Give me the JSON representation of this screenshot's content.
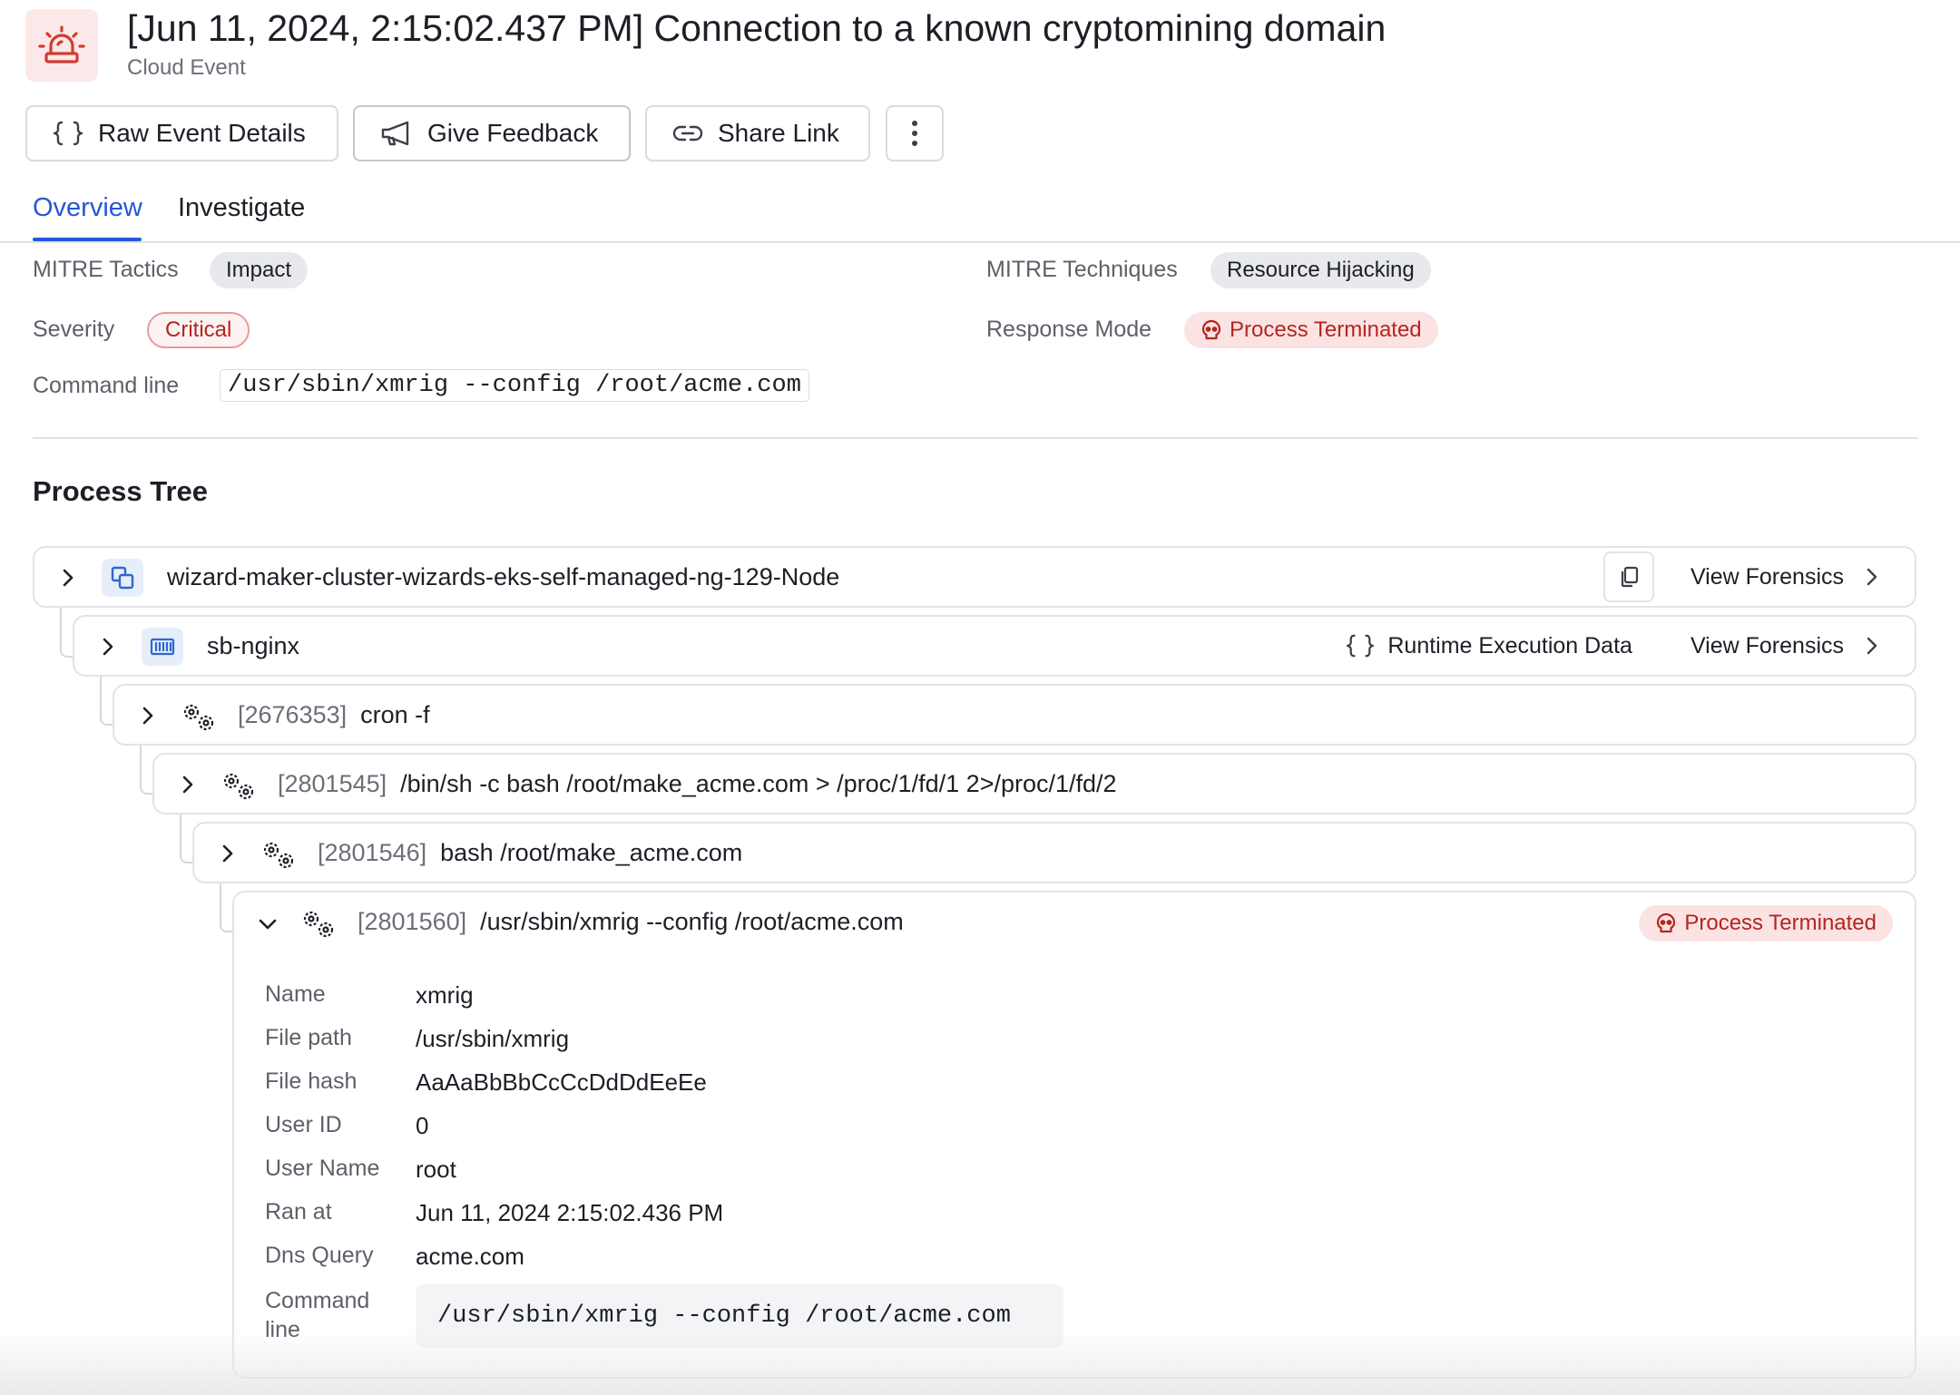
{
  "header": {
    "title": "[Jun 11, 2024, 2:15:02.437 PM] Connection to a known cryptomining domain",
    "subtitle": "Cloud Event",
    "icon": "siren-alert-icon"
  },
  "toolbar": {
    "raw_event_label": "Raw Event Details",
    "feedback_label": "Give Feedback",
    "share_label": "Share Link"
  },
  "tabs": [
    {
      "label": "Overview",
      "active": true
    },
    {
      "label": "Investigate",
      "active": false
    }
  ],
  "overview": {
    "mitre_tactics_label": "MITRE Tactics",
    "mitre_tactics_value": "Impact",
    "mitre_techniques_label": "MITRE Techniques",
    "mitre_techniques_value": "Resource Hijacking",
    "severity_label": "Severity",
    "severity_value": "Critical",
    "response_mode_label": "Response Mode",
    "response_mode_value": "Process Terminated",
    "command_line_label": "Command line",
    "command_line_value": "/usr/sbin/xmrig --config /root/acme.com"
  },
  "process_tree": {
    "title": "Process Tree",
    "node": {
      "name": "wizard-maker-cluster-wizards-eks-self-managed-ng-129-Node",
      "forensics_label": "View Forensics"
    },
    "container": {
      "name": "sb-nginx",
      "runtime_label": "Runtime Execution Data",
      "forensics_label": "View Forensics"
    },
    "processes": [
      {
        "pid": "[2676353]",
        "command": "cron -f"
      },
      {
        "pid": "[2801545]",
        "command": "/bin/sh -c bash /root/make_acme.com > /proc/1/fd/1 2>/proc/1/fd/2"
      },
      {
        "pid": "[2801546]",
        "command": "bash /root/make_acme.com"
      }
    ],
    "selected": {
      "pid": "[2801560]",
      "command": "/usr/sbin/xmrig --config /root/acme.com",
      "status": "Process Terminated",
      "details": [
        {
          "label": "Name",
          "value": "xmrig"
        },
        {
          "label": "File path",
          "value": "/usr/sbin/xmrig"
        },
        {
          "label": "File hash",
          "value": "AaAaBbBbCcCcDdDdEeEe"
        },
        {
          "label": "User ID",
          "value": "0"
        },
        {
          "label": "User Name",
          "value": "root"
        },
        {
          "label": "Ran at",
          "value": "Jun 11, 2024 2:15:02.436 PM"
        },
        {
          "label": "Dns Query",
          "value": "acme.com"
        }
      ],
      "command_line_label": "Command line",
      "command_line_value": "/usr/sbin/xmrig --config /root/acme.com"
    }
  },
  "colors": {
    "accent": "#2457d6",
    "critical": "#b3261e",
    "critical_bg": "#fbe3e3",
    "chip_grey": "#e8e9ec"
  }
}
